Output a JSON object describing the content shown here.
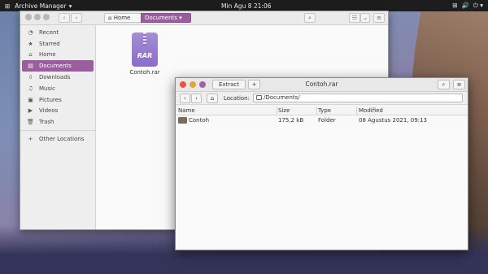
{
  "topbar": {
    "activities": "⊞",
    "app_name": "Archive Manager",
    "clock": "Min Agu 8  21:06",
    "tray": [
      "⊞",
      "🔊",
      "⏻ ▾"
    ]
  },
  "files_window": {
    "nav": {
      "back": "‹",
      "forward": "›"
    },
    "breadcrumb": {
      "home_icon": "⌂",
      "home": "Home",
      "current": "Documents ▾"
    },
    "toolbar": {
      "search": "⌕",
      "view_list": "☷",
      "view_sort": "⌄",
      "menu": "≡"
    },
    "sidebar": [
      {
        "icon": "◔",
        "label": "Recent"
      },
      {
        "icon": "★",
        "label": "Starred"
      },
      {
        "icon": "⌂",
        "label": "Home"
      },
      {
        "icon": "▤",
        "label": "Documents"
      },
      {
        "icon": "⇩",
        "label": "Downloads"
      },
      {
        "icon": "♫",
        "label": "Music"
      },
      {
        "icon": "▣",
        "label": "Pictures"
      },
      {
        "icon": "▶",
        "label": "Videos"
      },
      {
        "icon": "🗑",
        "label": "Trash"
      }
    ],
    "other_locations": {
      "icon": "+",
      "label": "Other Locations"
    },
    "file": {
      "icon_text": "RAR",
      "name": "Contoh.rar"
    }
  },
  "archive_window": {
    "title": "Contoh.rar",
    "extract_label": "Extract",
    "add_label": "+",
    "search_icon": "⌕",
    "menu_icon": "≡",
    "location_label": "Location:",
    "location_value": "/Documents/",
    "columns": [
      "Name",
      "Size",
      "Type",
      "Modified"
    ],
    "rows": [
      {
        "name": "Contoh",
        "size": "175,2 kB",
        "type": "Folder",
        "modified": "08 Agustus 2021, 09:13"
      }
    ]
  },
  "colors": {
    "accent": "#9a5e9e",
    "close": "#e9533f",
    "minimize": "#e3a43d",
    "maximize": "#9d62a6"
  }
}
